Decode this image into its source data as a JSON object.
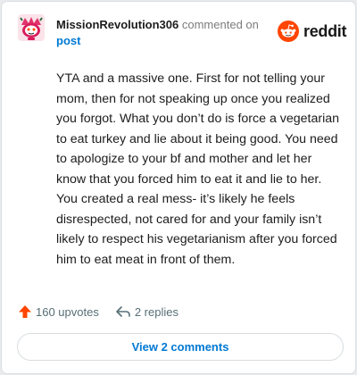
{
  "comment": {
    "username": "MissionRevolution306",
    "action_text": "commented on",
    "post_link": "post",
    "body": "YTA and a massive one. First for not telling your mom, then for not speaking up once you realized you forgot. What you don’t do is force a vegetarian to eat turkey and lie about it being good. You need to apologize to your bf and mother and let her know that you forced him to eat it and lie to her. You created a real mess- it’s likely he feels disrespected, not cared for and your family isn’t likely to respect his vegetarianism after you forced him to eat meat in front of them.",
    "upvotes": "160 upvotes",
    "replies": "2 replies",
    "view_comments": "View 2 comments"
  },
  "brand": {
    "wordmark": "reddit",
    "icon": "reddit-snoo-icon",
    "color": "#ff4500"
  },
  "avatar": {
    "icon": "snoo-avatar-icon",
    "bg": "#f8c8d4"
  },
  "colors": {
    "upvote": "#ff4500",
    "link": "#0079d3",
    "muted": "#576f76"
  },
  "icons": {
    "upvote": "upvote-arrow-icon",
    "reply": "reply-arrow-icon"
  }
}
